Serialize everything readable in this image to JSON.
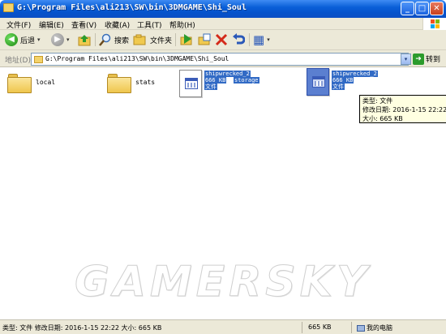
{
  "window": {
    "title": "G:\\Program Files\\ali213\\SW\\bin\\3DMGAME\\Shi_Soul",
    "minimize": "_",
    "maximize": "□",
    "close": "✕"
  },
  "menu": {
    "items": [
      "文件(F)",
      "编辑(E)",
      "查看(V)",
      "收藏(A)",
      "工具(T)",
      "帮助(H)"
    ]
  },
  "toolbar": {
    "back_label": "后退",
    "search_label": "搜索",
    "folders_label": "文件夹",
    "back_icon_glyph": "◀",
    "forward_icon_glyph": "▶",
    "dropdown_glyph": "▾",
    "views_icon_glyph": "▦"
  },
  "address": {
    "label": "地址(D)",
    "path": "G:\\Program Files\\ali213\\SW\\bin\\3DMGAME\\Shi_Soul",
    "go_label": "转到",
    "go_glyph": "➜",
    "dropdown_glyph": "▾"
  },
  "items": [
    {
      "name": "local",
      "kind": "folder"
    },
    {
      "name": "stats",
      "kind": "folder"
    },
    {
      "name": "shipwrecked_2",
      "size": "666 KB",
      "type": "文件",
      "extra": "storage",
      "selected": true
    },
    {
      "name": "shipwrecked_2",
      "size": "666 KB",
      "type": "文件",
      "selected": true
    }
  ],
  "tooltip": {
    "type_line": "类型: 文件",
    "date_line": "修改日期: 2016-1-15 22:22",
    "size_line": "大小: 665 KB"
  },
  "watermark": "GAMERSKY",
  "status": {
    "main": "类型: 文件 修改日期: 2016-1-15 22:22 大小: 665 KB",
    "size": "665 KB",
    "location": "我的电脑"
  },
  "colors": {
    "title_blue": "#0553cc",
    "chrome": "#ece9d8",
    "selection": "#316ac5",
    "tooltip_bg": "#ffffe1",
    "go_green": "#2c9b2c"
  },
  "icons": {
    "title": "folder-icon",
    "back": "back-arrow-icon",
    "forward": "forward-arrow-icon",
    "up": "up-folder-icon",
    "search": "search-magnifier-icon",
    "folders": "folders-icon",
    "move": "move-to-icon",
    "copy": "copy-to-icon",
    "delete": "delete-x-icon",
    "undo": "undo-icon",
    "views": "views-icon",
    "computer": "my-computer-icon"
  }
}
